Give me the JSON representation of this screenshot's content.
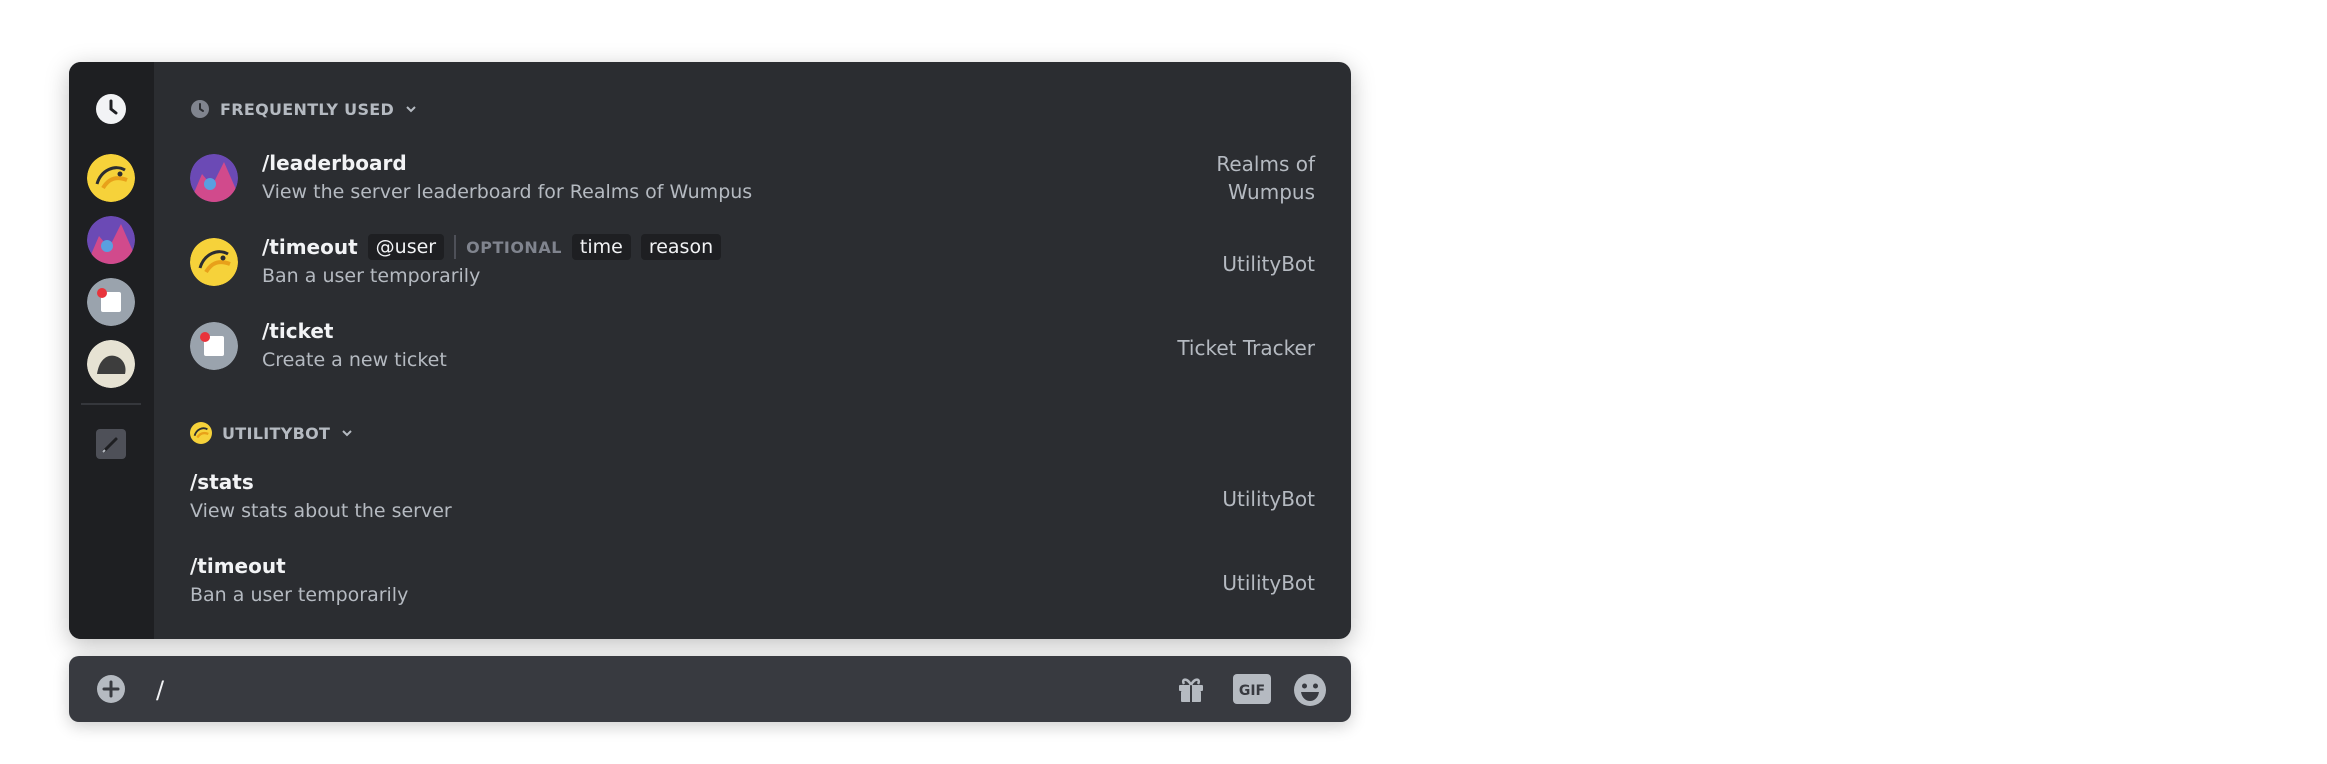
{
  "frequently_used": {
    "header": "FREQUENTLY USED",
    "items": [
      {
        "command": "/leaderboard",
        "description": "View the server leaderboard for Realms of Wumpus",
        "source_line1": "Realms of",
        "source_line2": "Wumpus",
        "avatar": "realms-avatar"
      },
      {
        "command": "/timeout",
        "description": "Ban a user temporarily",
        "source": "UtilityBot",
        "avatar": "utilitybot-avatar",
        "required_options": [
          "@user"
        ],
        "optional_label": "OPTIONAL",
        "optional_options": [
          "time",
          "reason"
        ]
      },
      {
        "command": "/ticket",
        "description": "Create a new ticket",
        "source": "Ticket Tracker",
        "avatar": "ticket-avatar"
      }
    ]
  },
  "utilitybot": {
    "header": "UTILITYBOT",
    "items": [
      {
        "command": "/stats",
        "description": "View stats about the server",
        "source": "UtilityBot"
      },
      {
        "command": "/timeout",
        "description": "Ban a user temporarily",
        "source": "UtilityBot"
      }
    ]
  },
  "message_input": {
    "value": "/"
  },
  "colors": {
    "popup_bg": "#2b2d31",
    "rail_bg": "#1e1f22",
    "input_bg": "#383a40",
    "text": "#f2f3f5",
    "muted": "#b5bac1"
  }
}
